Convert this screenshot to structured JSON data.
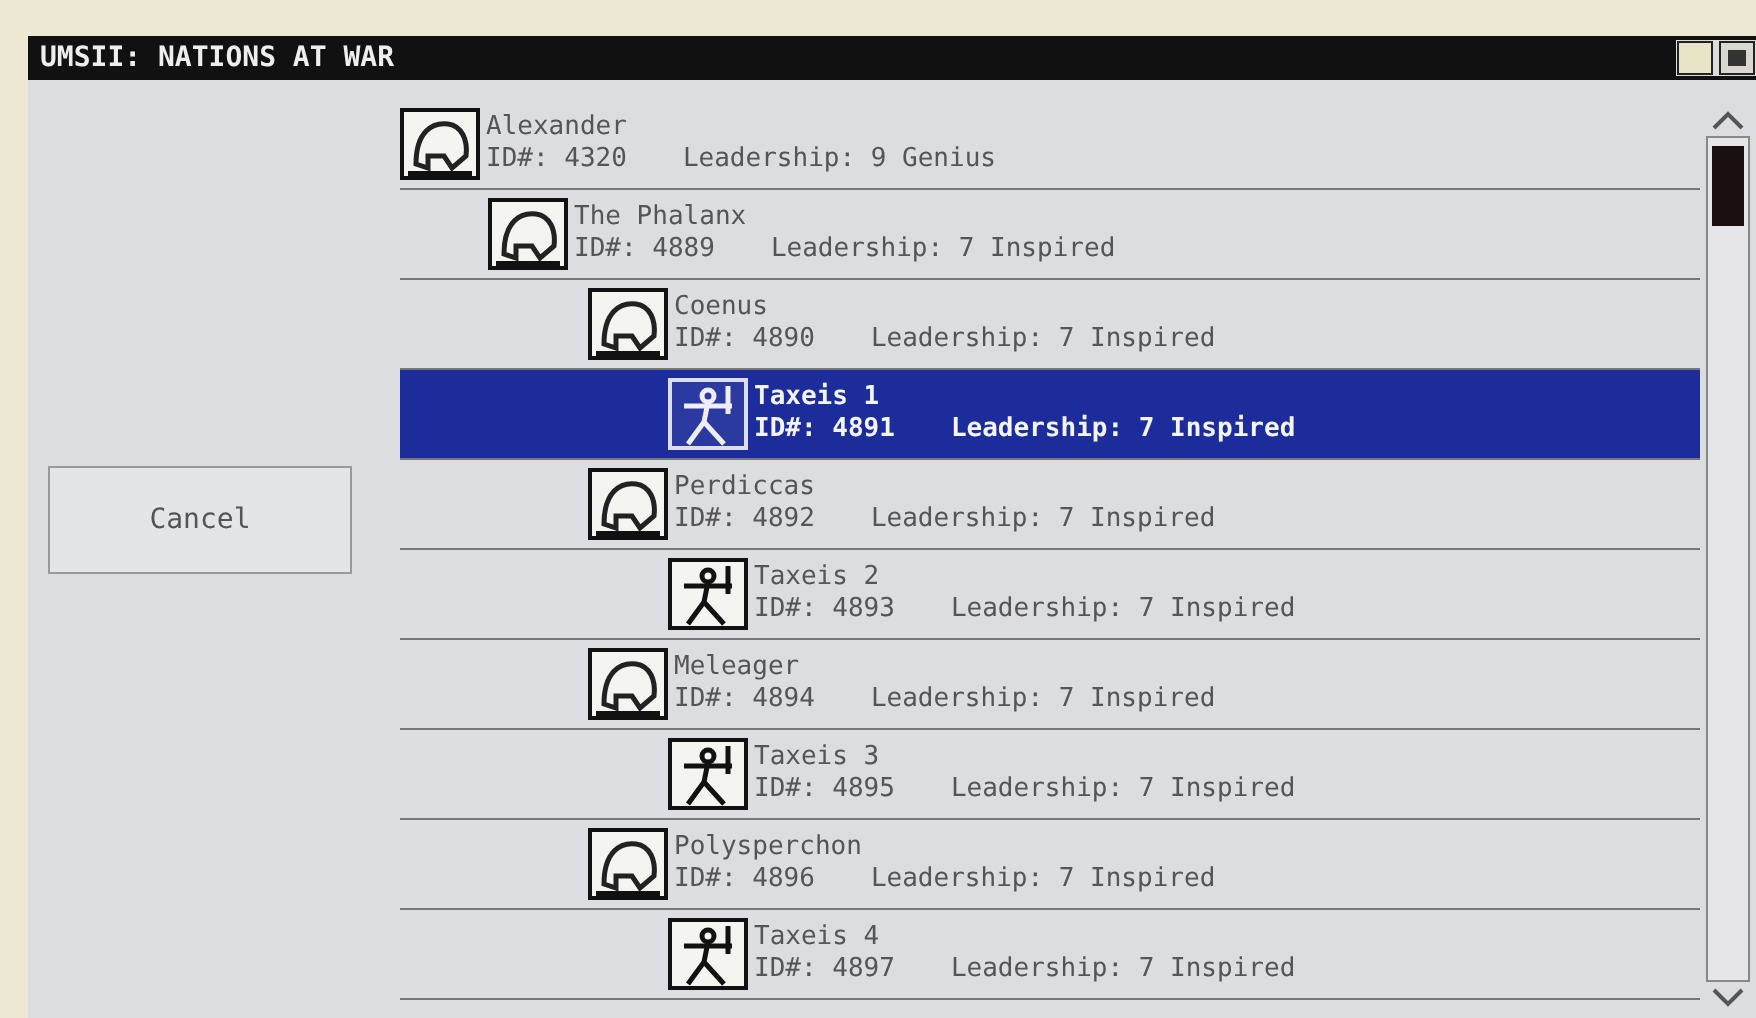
{
  "window": {
    "title": "UMSII: NATIONS AT WAR"
  },
  "cancel_button": {
    "label": "Cancel"
  },
  "tree": [
    {
      "kind": "leader",
      "name": "Alexander",
      "id": "ID#: 4320",
      "leadership": "Leadership: 9 Genius",
      "selected": false,
      "children": [
        {
          "kind": "leader",
          "name": "The Phalanx",
          "id": "ID#: 4889",
          "leadership": "Leadership: 7 Inspired",
          "selected": false,
          "children": [
            {
              "kind": "leader",
              "name": "Coenus",
              "id": "ID#: 4890",
              "leadership": "Leadership: 7 Inspired",
              "selected": false,
              "children": [
                {
                  "kind": "unit",
                  "name": "Taxeis 1",
                  "id": "ID#: 4891",
                  "leadership": "Leadership: 7 Inspired",
                  "selected": true
                }
              ]
            },
            {
              "kind": "leader",
              "name": "Perdiccas",
              "id": "ID#: 4892",
              "leadership": "Leadership: 7 Inspired",
              "selected": false,
              "children": [
                {
                  "kind": "unit",
                  "name": "Taxeis 2",
                  "id": "ID#: 4893",
                  "leadership": "Leadership: 7 Inspired",
                  "selected": false
                }
              ]
            },
            {
              "kind": "leader",
              "name": "Meleager",
              "id": "ID#: 4894",
              "leadership": "Leadership: 7 Inspired",
              "selected": false,
              "children": [
                {
                  "kind": "unit",
                  "name": "Taxeis 3",
                  "id": "ID#: 4895",
                  "leadership": "Leadership: 7 Inspired",
                  "selected": false
                }
              ]
            },
            {
              "kind": "leader",
              "name": "Polysperchon",
              "id": "ID#: 4896",
              "leadership": "Leadership: 7 Inspired",
              "selected": false,
              "children": [
                {
                  "kind": "unit",
                  "name": "Taxeis 4",
                  "id": "ID#: 4897",
                  "leadership": "Leadership: 7 Inspired",
                  "selected": false
                }
              ]
            }
          ]
        }
      ]
    }
  ]
}
